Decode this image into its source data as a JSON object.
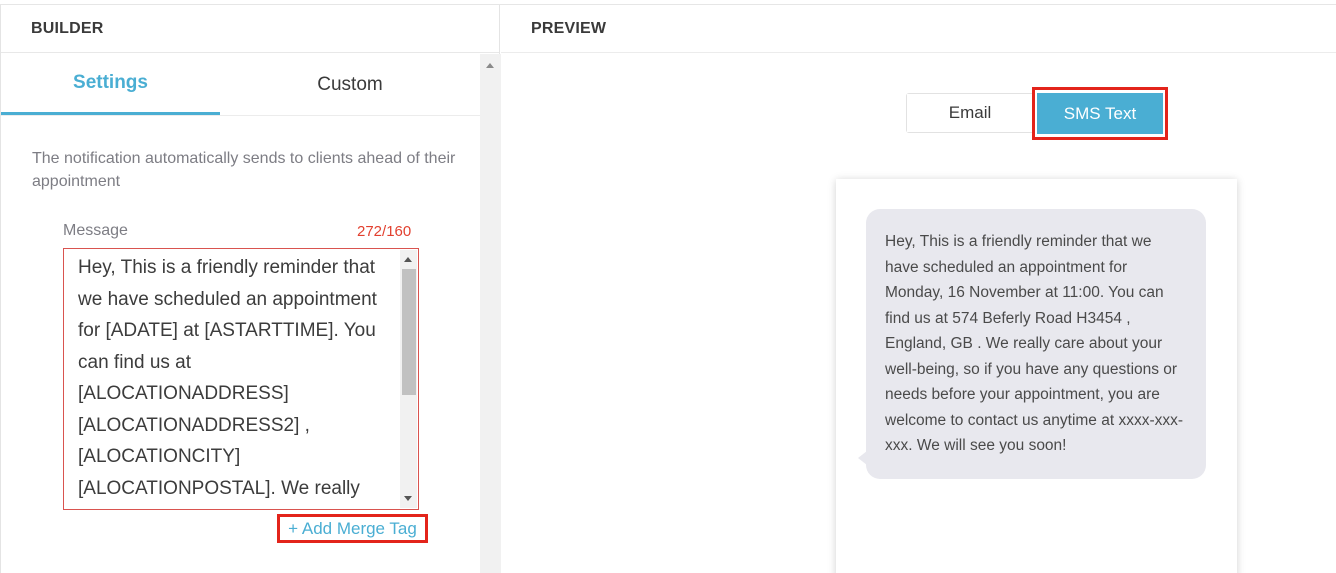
{
  "builder": {
    "title": "BUILDER",
    "tabs": [
      {
        "label": "Settings",
        "active": true
      },
      {
        "label": "Custom",
        "active": false
      }
    ],
    "description": "The notification automatically sends to clients ahead of their appointment",
    "message": {
      "label": "Message",
      "count": "272/160",
      "value": "Hey, This is a friendly reminder that we have scheduled an appointment for [ADATE] at [ASTARTTIME]. You can find us at [ALOCATIONADDRESS] [ALOCATIONADDRESS2] , [ALOCATIONCITY] [ALOCATIONPOSTAL]. We really"
    },
    "add_merge_tag": "+ Add Merge Tag"
  },
  "preview": {
    "title": "PREVIEW",
    "toggle": {
      "email_label": "Email",
      "sms_label": "SMS Text",
      "selected": "SMS Text"
    },
    "sms_message": "Hey, This is a friendly reminder that we have scheduled an appointment for Monday, 16 November at 11:00. You can find us at 574 Beferly Road H3454 , England, GB . We really care about your well-being, so if you have any questions or needs before your appointment, you are welcome to contact us anytime at xxxx-xxx-xxx. We will see you soon!"
  },
  "colors": {
    "accent": "#4aaed3",
    "highlight": "#e3241b",
    "error": "#e2402f"
  }
}
